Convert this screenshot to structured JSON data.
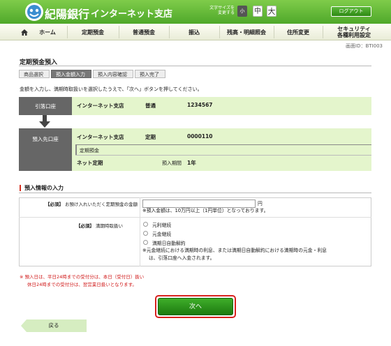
{
  "header": {
    "bank_name": "紀陽銀行",
    "branch_name": "インターネット支店",
    "font_size_label": "文字サイズを\n変更する",
    "font_small": "小",
    "font_mid": "中",
    "font_big": "大",
    "logout": "ログアウト"
  },
  "nav": {
    "home": "ホーム",
    "items": [
      "定期預金",
      "普通預金",
      "振込",
      "残高・明細照会",
      "住所変更",
      "セキュリティ\n各種利用設定"
    ]
  },
  "screen_id": "画面ID：BTI003",
  "page_title": "定期預金預入",
  "steps": [
    "商品選択",
    "預入金額入力",
    "預入内容確認",
    "預入完了"
  ],
  "active_step": 1,
  "instruction": "金額を入力し、満期時取扱いを選択したうえで、「次へ」ボタンを押してください。",
  "from_account": {
    "label": "引落口座",
    "branch": "インターネット支店",
    "type": "普通",
    "number": "1234567"
  },
  "to_account": {
    "label": "預入先口座",
    "branch": "インターネット支店",
    "type": "定期",
    "number": "0000110",
    "product_header": "定期預金",
    "product": "ネット定期",
    "period_label": "預入期間",
    "period": "1年"
  },
  "section_title": "預入情報の入力",
  "form": {
    "amount_required": "【必須】",
    "amount_label": "お預け入れいただく定期預金の金額",
    "amount_value": "",
    "amount_unit": "円",
    "amount_note": "※預入金額は、10万円以上（1円単位）となっております。",
    "maturity_required": "【必須】",
    "maturity_label": "満期時取扱い",
    "options": [
      "元利継続",
      "元金継続",
      "満期日自動解約"
    ],
    "maturity_note_1": "※元金継続における満期時の利息、または満期日自動解約における満期時の元金・利息",
    "maturity_note_2": "は、引落口座へ入金されます。"
  },
  "warnings": [
    "※ 預入日は、平日24時までの受付分は、本日（受付日）扱い",
    "休日24時までの受付分は、翌営業日扱いとなります。"
  ],
  "next_button": "次へ",
  "back_button": "戻る",
  "colors": {
    "brand_green": "#4fa82a",
    "panel_green": "#e4f5cc",
    "warn_red": "#d01818"
  }
}
